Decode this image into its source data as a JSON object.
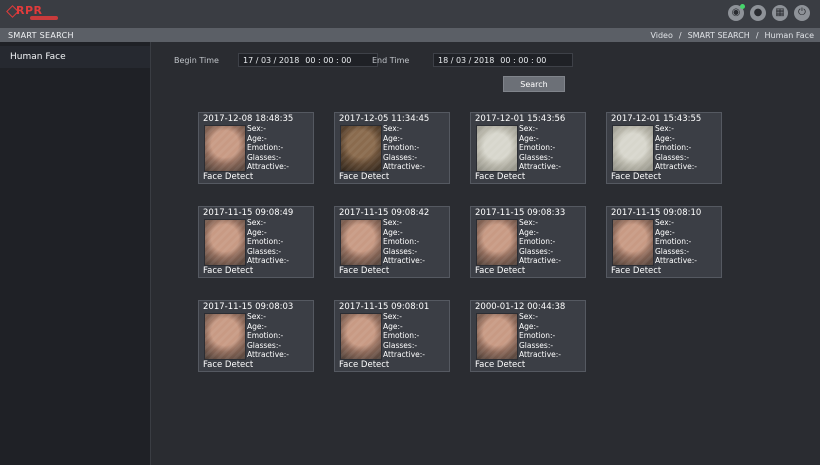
{
  "app": {
    "logo_text": "RPR",
    "icons": [
      "eye-icon",
      "user-icon",
      "grid-icon",
      "power-icon"
    ]
  },
  "header": {
    "title": "SMART SEARCH",
    "breadcrumb": [
      "Video",
      "/",
      "SMART SEARCH",
      "/",
      "Human Face"
    ]
  },
  "sidebar": {
    "items": [
      {
        "label": "Human Face"
      }
    ]
  },
  "search": {
    "begin_label": "Begin Time",
    "begin_date": "17 / 03 / 2018",
    "begin_time": "00 : 00 : 00",
    "end_label": "End Time",
    "end_date": "18 / 03 / 2018",
    "end_time": "00 : 00 : 00",
    "button_label": "Search"
  },
  "results": [
    {
      "timestamp": "2017-12-08 18:48:35",
      "sex": "Sex:-",
      "age": "Age:-",
      "emotion": "Emotion:-",
      "glasses": "Glasses:-",
      "attractive": "Attractive:-",
      "event": "Face Detect",
      "tone": "normal"
    },
    {
      "timestamp": "2017-12-05 11:34:45",
      "sex": "Sex:-",
      "age": "Age:-",
      "emotion": "Emotion:-",
      "glasses": "Glasses:-",
      "attractive": "Attractive:-",
      "event": "Face Detect",
      "tone": "dark"
    },
    {
      "timestamp": "2017-12-01 15:43:56",
      "sex": "Sex:-",
      "age": "Age:-",
      "emotion": "Emotion:-",
      "glasses": "Glasses:-",
      "attractive": "Attractive:-",
      "event": "Face Detect",
      "tone": "pale"
    },
    {
      "timestamp": "2017-12-01 15:43:55",
      "sex": "Sex:-",
      "age": "Age:-",
      "emotion": "Emotion:-",
      "glasses": "Glasses:-",
      "attractive": "Attractive:-",
      "event": "Face Detect",
      "tone": "pale"
    },
    {
      "timestamp": "2017-11-15 09:08:49",
      "sex": "Sex:-",
      "age": "Age:-",
      "emotion": "Emotion:-",
      "glasses": "Glasses:-",
      "attractive": "Attractive:-",
      "event": "Face Detect",
      "tone": "normal"
    },
    {
      "timestamp": "2017-11-15 09:08:42",
      "sex": "Sex:-",
      "age": "Age:-",
      "emotion": "Emotion:-",
      "glasses": "Glasses:-",
      "attractive": "Attractive:-",
      "event": "Face Detect",
      "tone": "normal"
    },
    {
      "timestamp": "2017-11-15 09:08:33",
      "sex": "Sex:-",
      "age": "Age:-",
      "emotion": "Emotion:-",
      "glasses": "Glasses:-",
      "attractive": "Attractive:-",
      "event": "Face Detect",
      "tone": "normal"
    },
    {
      "timestamp": "2017-11-15 09:08:10",
      "sex": "Sex:-",
      "age": "Age:-",
      "emotion": "Emotion:-",
      "glasses": "Glasses:-",
      "attractive": "Attractive:-",
      "event": "Face Detect",
      "tone": "normal"
    },
    {
      "timestamp": "2017-11-15 09:08:03",
      "sex": "Sex:-",
      "age": "Age:-",
      "emotion": "Emotion:-",
      "glasses": "Glasses:-",
      "attractive": "Attractive:-",
      "event": "Face Detect",
      "tone": "normal"
    },
    {
      "timestamp": "2017-11-15 09:08:01",
      "sex": "Sex:-",
      "age": "Age:-",
      "emotion": "Emotion:-",
      "glasses": "Glasses:-",
      "attractive": "Attractive:-",
      "event": "Face Detect",
      "tone": "normal"
    },
    {
      "timestamp": "2000-01-12 00:44:38",
      "sex": "Sex:-",
      "age": "Age:-",
      "emotion": "Emotion:-",
      "glasses": "Glasses:-",
      "attractive": "Attractive:-",
      "event": "Face Detect",
      "tone": "normal"
    }
  ]
}
